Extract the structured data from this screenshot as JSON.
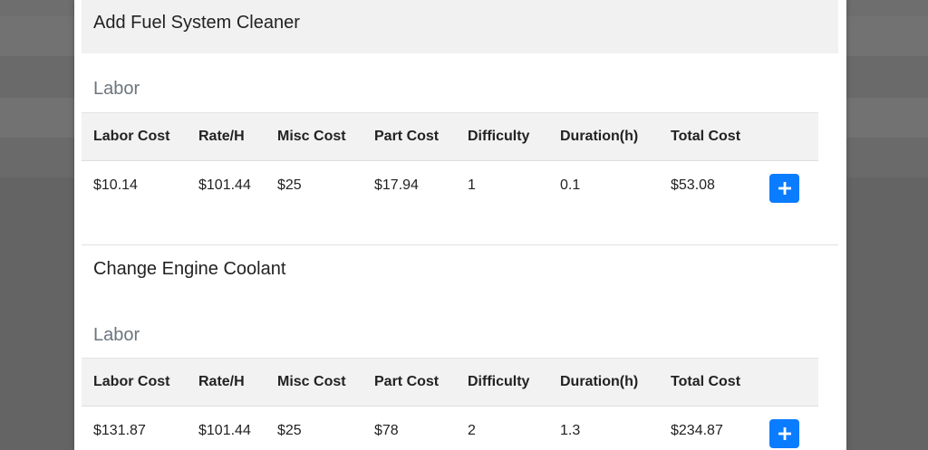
{
  "modal": {
    "header_title": "Add Fuel System Cleaner"
  },
  "sections": [
    {
      "title": "",
      "subheading": "Labor",
      "columns": [
        "Labor Cost",
        "Rate/H",
        "Misc Cost",
        "Part Cost",
        "Difficulty",
        "Duration(h)",
        "Total Cost"
      ],
      "row": [
        "$10.14",
        "$101.44",
        "$25",
        "$17.94",
        "1",
        "0.1",
        "$53.08"
      ]
    },
    {
      "title": "Change Engine Coolant",
      "subheading": "Labor",
      "columns": [
        "Labor Cost",
        "Rate/H",
        "Misc Cost",
        "Part Cost",
        "Difficulty",
        "Duration(h)",
        "Total Cost"
      ],
      "row": [
        "$131.87",
        "$101.44",
        "$25",
        "$78",
        "2",
        "1.3",
        "$234.87"
      ]
    }
  ],
  "colors": {
    "accent": "#0a7cff",
    "header_bg": "#f1f1f1",
    "table_head_bg": "#f2f2f2",
    "muted_text": "#6c757d"
  },
  "icons": {
    "add": "plus-icon"
  }
}
